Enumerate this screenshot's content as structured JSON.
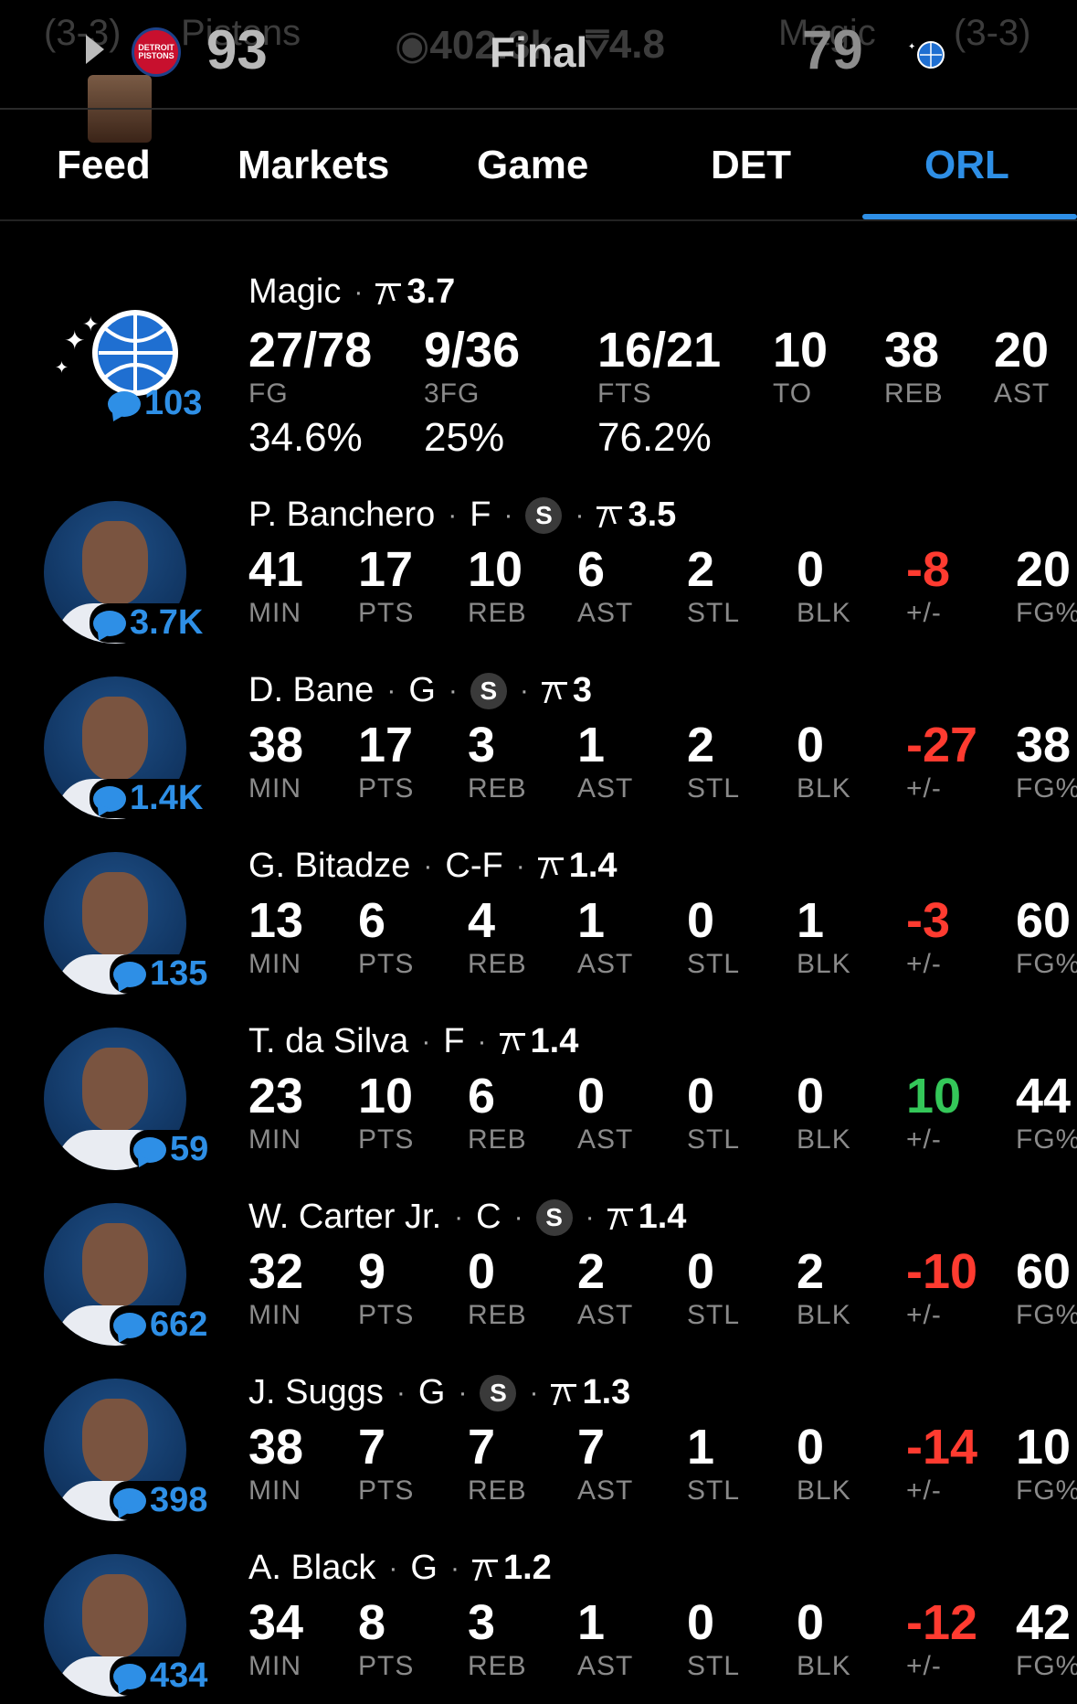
{
  "scoreboard": {
    "home_record": "(3-3)",
    "home_name": "Pistons",
    "home_score": "93",
    "status": "Final",
    "views": "402.3k",
    "rating": "4.8",
    "away_name": "Magic",
    "away_score": "79",
    "away_record": "(3-3)",
    "home_logo_text": "DETROIT PISTONS"
  },
  "tabs": [
    {
      "label": "Feed"
    },
    {
      "label": "Markets"
    },
    {
      "label": "Game"
    },
    {
      "label": "DET"
    },
    {
      "label": "ORL"
    }
  ],
  "team": {
    "name": "Magic",
    "rating": "3.7",
    "comments": "103",
    "stats": [
      {
        "value": "27/78",
        "label": "FG",
        "pct": "34.6%"
      },
      {
        "value": "9/36",
        "label": "3FG",
        "pct": "25%"
      },
      {
        "value": "16/21",
        "label": "FTS",
        "pct": "76.2%"
      },
      {
        "value": "10",
        "label": "TO"
      },
      {
        "value": "38",
        "label": "REB"
      },
      {
        "value": "20",
        "label": "AST"
      }
    ]
  },
  "stat_labels": {
    "min": "MIN",
    "pts": "PTS",
    "reb": "REB",
    "ast": "AST",
    "stl": "STL",
    "blk": "BLK",
    "pm": "+/-",
    "fg": "FG%"
  },
  "players": [
    {
      "name": "P. Banchero",
      "pos": "F",
      "starter": true,
      "badge": "S",
      "rating": "3.5",
      "comments": "3.7K",
      "min": "41",
      "pts": "17",
      "reb": "10",
      "ast": "6",
      "stl": "2",
      "blk": "0",
      "pm": "-8",
      "fg": "20"
    },
    {
      "name": "D. Bane",
      "pos": "G",
      "starter": true,
      "badge": "S",
      "rating": "3",
      "comments": "1.4K",
      "min": "38",
      "pts": "17",
      "reb": "3",
      "ast": "1",
      "stl": "2",
      "blk": "0",
      "pm": "-27",
      "fg": "38"
    },
    {
      "name": "G. Bitadze",
      "pos": "C-F",
      "starter": false,
      "badge": "",
      "rating": "1.4",
      "comments": "135",
      "min": "13",
      "pts": "6",
      "reb": "4",
      "ast": "1",
      "stl": "0",
      "blk": "1",
      "pm": "-3",
      "fg": "60"
    },
    {
      "name": "T. da Silva",
      "pos": "F",
      "starter": false,
      "badge": "",
      "rating": "1.4",
      "comments": "59",
      "min": "23",
      "pts": "10",
      "reb": "6",
      "ast": "0",
      "stl": "0",
      "blk": "0",
      "pm": "10",
      "fg": "44"
    },
    {
      "name": "W. Carter Jr.",
      "pos": "C",
      "starter": true,
      "badge": "S",
      "rating": "1.4",
      "comments": "662",
      "min": "32",
      "pts": "9",
      "reb": "0",
      "ast": "2",
      "stl": "0",
      "blk": "2",
      "pm": "-10",
      "fg": "60"
    },
    {
      "name": "J. Suggs",
      "pos": "G",
      "starter": true,
      "badge": "S",
      "rating": "1.3",
      "comments": "398",
      "min": "38",
      "pts": "7",
      "reb": "7",
      "ast": "7",
      "stl": "1",
      "blk": "0",
      "pm": "-14",
      "fg": "10"
    },
    {
      "name": "A. Black",
      "pos": "G",
      "starter": false,
      "badge": "",
      "rating": "1.2",
      "comments": "434",
      "min": "34",
      "pts": "8",
      "reb": "3",
      "ast": "1",
      "stl": "0",
      "blk": "0",
      "pm": "-12",
      "fg": "42"
    }
  ],
  "colors": {
    "accent": "#2e8fe6",
    "negative": "#ff3b30",
    "positive": "#34c759",
    "label": "#8a8a8a"
  },
  "icons": {
    "play": "play-icon",
    "views": "eye-icon",
    "rating": "rating-icon",
    "comments": "chat-bubble-icon",
    "starter": "starter-badge"
  }
}
